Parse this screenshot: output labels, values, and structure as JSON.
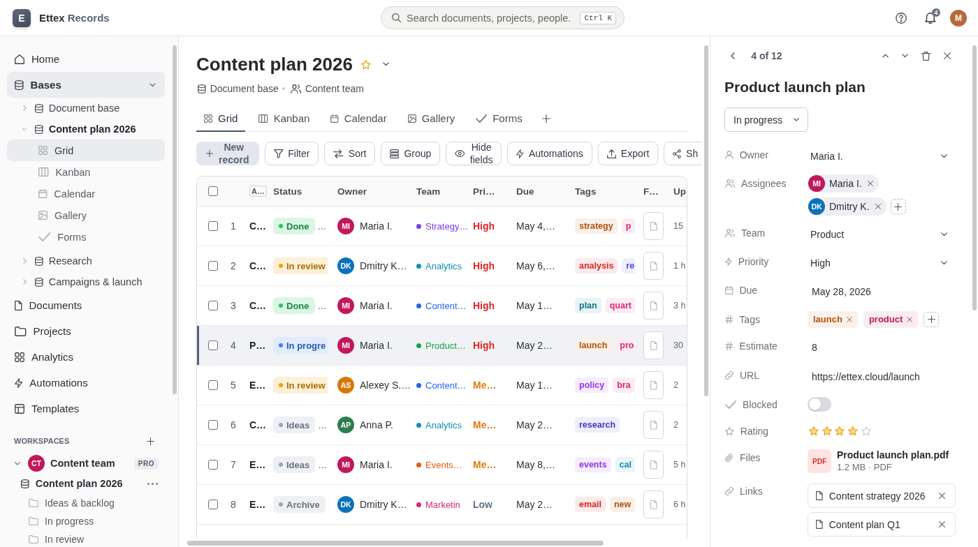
{
  "topbar": {
    "brand": {
      "logo_letter": "E",
      "name": "Ettex",
      "suffix": "Records"
    },
    "search": {
      "placeholder": "Search documents, projects, people.",
      "shortcut": "Ctrl K"
    },
    "notifications": {
      "count": "4"
    },
    "user": {
      "initials": "M",
      "color": "#b8693a"
    }
  },
  "sidebar": {
    "items": [
      {
        "label": "Home",
        "selected": false
      },
      {
        "label": "Bases",
        "selected": true,
        "expanded": true,
        "children": [
          {
            "label": "Document base",
            "selected": false,
            "expanded": false
          },
          {
            "label": "Content plan 2026",
            "selected": false,
            "expanded": true,
            "children": [
              {
                "label": "Grid",
                "selected": true
              },
              {
                "label": "Kanban",
                "selected": false
              },
              {
                "label": "Calendar",
                "selected": false
              },
              {
                "label": "Gallery",
                "selected": false
              },
              {
                "label": "Forms",
                "selected": false
              }
            ]
          },
          {
            "label": "Research",
            "selected": false,
            "expanded": false
          },
          {
            "label": "Campaigns & launch",
            "selected": false,
            "expanded": false
          }
        ]
      },
      {
        "label": "Documents",
        "selected": false
      },
      {
        "label": "Projects",
        "selected": false
      },
      {
        "label": "Analytics",
        "selected": false
      },
      {
        "label": "Automations",
        "selected": false
      },
      {
        "label": "Templates",
        "selected": false
      }
    ],
    "workspaces": {
      "title": "WORKSPACES",
      "items": [
        {
          "label": "Content team",
          "initials": "CT",
          "color": "#c0185a",
          "badge": "PRO",
          "expanded": true,
          "children": [
            {
              "label": "Content plan 2026",
              "children": [
                {
                  "label": "Ideas & backlog"
                },
                {
                  "label": "In progress"
                },
                {
                  "label": "In review"
                }
              ]
            }
          ]
        }
      ]
    }
  },
  "page": {
    "title": "Content plan 2026",
    "favorite": true,
    "meta": [
      "Document base",
      "Content team"
    ],
    "tabs": [
      {
        "label": "Grid",
        "selected": true
      },
      {
        "label": "Kanban",
        "selected": false
      },
      {
        "label": "Calendar",
        "selected": false
      },
      {
        "label": "Gallery",
        "selected": false
      },
      {
        "label": "Forms",
        "selected": false
      }
    ],
    "toolbar": [
      {
        "label": "New record",
        "kind": "primary"
      },
      {
        "label": "Filter",
        "kind": "outline"
      },
      {
        "label": "Sort",
        "kind": "outline"
      },
      {
        "label": "Group",
        "kind": "outline"
      },
      {
        "label": "Hide fields",
        "kind": "outline"
      },
      {
        "label": "Automations",
        "kind": "outline"
      },
      {
        "label": "Export",
        "kind": "outline"
      },
      {
        "label": "Sh",
        "kind": "outline"
      }
    ],
    "table": {
      "all_checked": false,
      "columns": [
        {
          "label": "A…",
          "kind": "chip"
        },
        {
          "label": "Status",
          "kind": "text"
        },
        {
          "label": "Owner",
          "kind": "text"
        },
        {
          "label": "Team",
          "kind": "text"
        },
        {
          "label": "Pri…",
          "kind": "text"
        },
        {
          "label": "Due",
          "kind": "text"
        },
        {
          "label": "Tags",
          "kind": "text"
        },
        {
          "label": "F…",
          "kind": "text"
        },
        {
          "label": "Up",
          "kind": "text"
        }
      ],
      "rows": [
        {
          "checked": false,
          "selected": false,
          "number": "1",
          "name": "C…",
          "status": {
            "label": "Done",
            "color": "#22c55e"
          },
          "status_trail": "…",
          "owner": {
            "initials": "MI",
            "name": "Maria I.",
            "color": "#c2185b"
          },
          "team": {
            "label": "Strategy…",
            "color": "#7c3aed"
          },
          "priority": {
            "label": "High",
            "color": "#dc2626"
          },
          "due": "May 4,…",
          "tags": [
            {
              "label": "strategy",
              "color": "#b45309"
            },
            {
              "label": "p",
              "color": "#db2777"
            }
          ],
          "updated": "15"
        },
        {
          "checked": false,
          "selected": false,
          "number": "2",
          "name": "C…",
          "status": {
            "label": "In review",
            "color": "#f59e0b"
          },
          "owner": {
            "initials": "DK",
            "name": "Dmitry K…",
            "color": "#0b72b9"
          },
          "team": {
            "label": "Analytics",
            "color": "#0e91b0"
          },
          "priority": {
            "label": "High",
            "color": "#dc2626"
          },
          "due": "May 6,…",
          "tags": [
            {
              "label": "analysis",
              "color": "#dc2626"
            },
            {
              "label": "re",
              "color": "#4f46e5"
            }
          ],
          "updated": "1 h"
        },
        {
          "checked": false,
          "selected": false,
          "number": "3",
          "name": "C…",
          "status": {
            "label": "Done",
            "color": "#22c55e"
          },
          "status_trail": "…",
          "owner": {
            "initials": "MI",
            "name": "Maria I.",
            "color": "#c2185b"
          },
          "team": {
            "label": "Content…",
            "color": "#2563eb"
          },
          "priority": {
            "label": "High",
            "color": "#dc2626"
          },
          "due": "May 1…",
          "tags": [
            {
              "label": "plan",
              "color": "#0e7490"
            },
            {
              "label": "quart",
              "color": "#db2777"
            }
          ],
          "updated": "3 h"
        },
        {
          "checked": false,
          "selected": true,
          "number": "4",
          "name": "P…",
          "status": {
            "label": "In progre",
            "color": "#3b82f6"
          },
          "owner": {
            "initials": "MI",
            "name": "Maria I.",
            "color": "#c2185b"
          },
          "team": {
            "label": "Product…",
            "color": "#16a34a"
          },
          "priority": {
            "label": "High",
            "color": "#dc2626"
          },
          "due": "May 2…",
          "tags": [
            {
              "label": "launch",
              "color": "#b45309"
            },
            {
              "label": "pro",
              "color": "#db2777"
            }
          ],
          "updated": "30"
        },
        {
          "checked": false,
          "selected": false,
          "number": "5",
          "name": "E…",
          "status": {
            "label": "In review",
            "color": "#f59e0b"
          },
          "owner": {
            "initials": "AS",
            "name": "Alexey S.…",
            "color": "#d97706"
          },
          "team": {
            "label": "Content…",
            "color": "#2563eb"
          },
          "priority": {
            "label": "Me…",
            "color": "#e07b0c"
          },
          "due": "May 1…",
          "tags": [
            {
              "label": "policy",
              "color": "#9333ea"
            },
            {
              "label": "bra",
              "color": "#db2777"
            }
          ],
          "updated": "2"
        },
        {
          "checked": false,
          "selected": false,
          "number": "6",
          "name": "C…",
          "status": {
            "label": "Ideas",
            "color": "#94a3b8"
          },
          "status_trail": "…",
          "owner": {
            "initials": "AP",
            "name": "Anna P.",
            "color": "#2e7d4f"
          },
          "team": {
            "label": "Analytics",
            "color": "#0e91b0"
          },
          "priority": {
            "label": "Me…",
            "color": "#e07b0c"
          },
          "due": "May 2…",
          "tags": [
            {
              "label": "research",
              "color": "#4338ca"
            }
          ],
          "updated": "2"
        },
        {
          "checked": false,
          "selected": false,
          "number": "7",
          "name": "E…",
          "status": {
            "label": "Ideas",
            "color": "#94a3b8"
          },
          "status_trail": "…",
          "owner": {
            "initials": "MI",
            "name": "Maria I.",
            "color": "#c2185b"
          },
          "team": {
            "label": "Events…",
            "color": "#ea580c"
          },
          "priority": {
            "label": "Me…",
            "color": "#e07b0c"
          },
          "due": "May 8,…",
          "tags": [
            {
              "label": "events",
              "color": "#9333ea"
            },
            {
              "label": "cal",
              "color": "#0891b2"
            }
          ],
          "updated": "5 h"
        },
        {
          "checked": false,
          "selected": false,
          "number": "8",
          "name": "E…",
          "status": {
            "label": "Archive",
            "color": "#9ca3af"
          },
          "owner": {
            "initials": "DK",
            "name": "Dmitry K…",
            "color": "#0b72b9"
          },
          "team": {
            "label": "Marketin",
            "color": "#db2777"
          },
          "priority": {
            "label": "Low",
            "color": "#64748b"
          },
          "due": "May 2…",
          "tags": [
            {
              "label": "email",
              "color": "#dc2626"
            },
            {
              "label": "new",
              "color": "#b45309"
            }
          ],
          "updated": "6 h"
        }
      ]
    }
  },
  "record": {
    "pager": "4 of 12",
    "title": "Product launch plan",
    "status": "In progress",
    "fields": [
      {
        "label": "Owner",
        "kind": "select",
        "value": "Maria I."
      },
      {
        "label": "Assignees",
        "kind": "people",
        "people": [
          {
            "initials": "MI",
            "name": "Maria I.",
            "color": "#c2185b"
          },
          {
            "initials": "DK",
            "name": "Dmitry K.",
            "color": "#0b72b9"
          }
        ]
      },
      {
        "label": "Team",
        "kind": "select",
        "value": "Product"
      },
      {
        "label": "Priority",
        "kind": "select",
        "value": "High"
      },
      {
        "label": "Due",
        "kind": "text",
        "value": "May 28, 2026"
      },
      {
        "label": "Tags",
        "kind": "tags",
        "tags": [
          {
            "label": "launch",
            "color": "#b45309"
          },
          {
            "label": "product",
            "color": "#be185d"
          }
        ]
      },
      {
        "label": "Estimate",
        "kind": "text",
        "value": "8"
      },
      {
        "label": "URL",
        "kind": "text",
        "value": "https://ettex.cloud/launch"
      },
      {
        "label": "Blocked",
        "kind": "toggle",
        "on": false
      },
      {
        "label": "Rating",
        "kind": "rating",
        "stars": 4
      },
      {
        "label": "Files",
        "kind": "file",
        "name": "Product launch plan.pdf",
        "meta": "1.2 MB · PDF",
        "type_label": "PDF"
      },
      {
        "label": "Links",
        "kind": "links",
        "links": [
          "Content strategy 2026",
          "Content plan Q1"
        ]
      }
    ]
  }
}
